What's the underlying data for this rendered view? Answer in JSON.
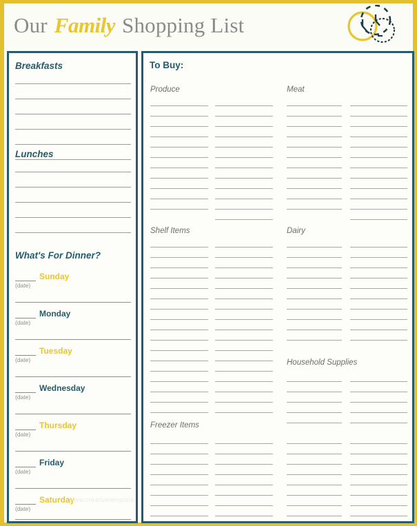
{
  "header": {
    "title_pre": "Our ",
    "title_script": "Family",
    "title_post": " Shopping List",
    "logo_name": "clock-circles-logo"
  },
  "colors": {
    "border_yellow": "#e3c02e",
    "panel_teal": "#245c6b",
    "accent_yellow": "#e9c52e",
    "rule_gray": "#9a9a9a",
    "paper": "#fdfdfa"
  },
  "left_panel": {
    "sections": [
      {
        "label": "Breakfasts",
        "lines": 6
      },
      {
        "label": "Lunches",
        "lines": 6
      }
    ],
    "dinner": {
      "label": "What's For Dinner?",
      "date_label": "(date)",
      "days": [
        {
          "name": "Sunday",
          "color": "yellow"
        },
        {
          "name": "Monday",
          "color": "teal"
        },
        {
          "name": "Tuesday",
          "color": "yellow"
        },
        {
          "name": "Wednesday",
          "color": "teal"
        },
        {
          "name": "Thursday",
          "color": "yellow"
        },
        {
          "name": "Friday",
          "color": "teal"
        },
        {
          "name": "Saturday",
          "color": "yellow"
        }
      ]
    },
    "watermark": "www.creativetemplate.net"
  },
  "right_panel": {
    "title": "To Buy:",
    "categories": [
      {
        "label": "Produce",
        "column": 1,
        "span": 2
      },
      {
        "label": "Meat",
        "column": 3,
        "span": 2
      },
      {
        "label": "Shelf Items",
        "column": 1,
        "span": 2
      },
      {
        "label": "Dairy",
        "column": 3,
        "span": 2
      },
      {
        "label": "Household Supplies",
        "column": 3,
        "span": 2
      },
      {
        "label": "Freezer Items",
        "column": 1,
        "span": 2
      }
    ]
  }
}
